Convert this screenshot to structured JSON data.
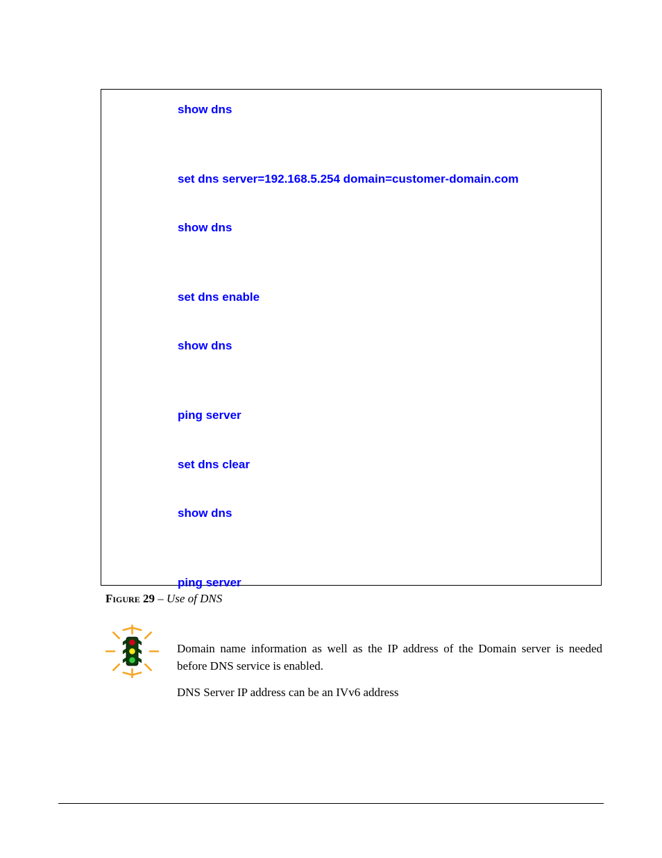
{
  "commands": [
    "show dns",
    "set dns server=192.168.5.254 domain=customer-domain.com",
    "show dns",
    "set dns enable",
    "show dns",
    "ping server",
    "set dns clear",
    "show dns",
    "ping server"
  ],
  "caption": {
    "label": "Figure 29",
    "sep": " – ",
    "title": "Use of DNS"
  },
  "note": {
    "p1": "Domain name information as well as the IP address of the Domain server is needed before DNS service is enabled.",
    "p2": "DNS Server IP address can be an IVv6 address"
  }
}
